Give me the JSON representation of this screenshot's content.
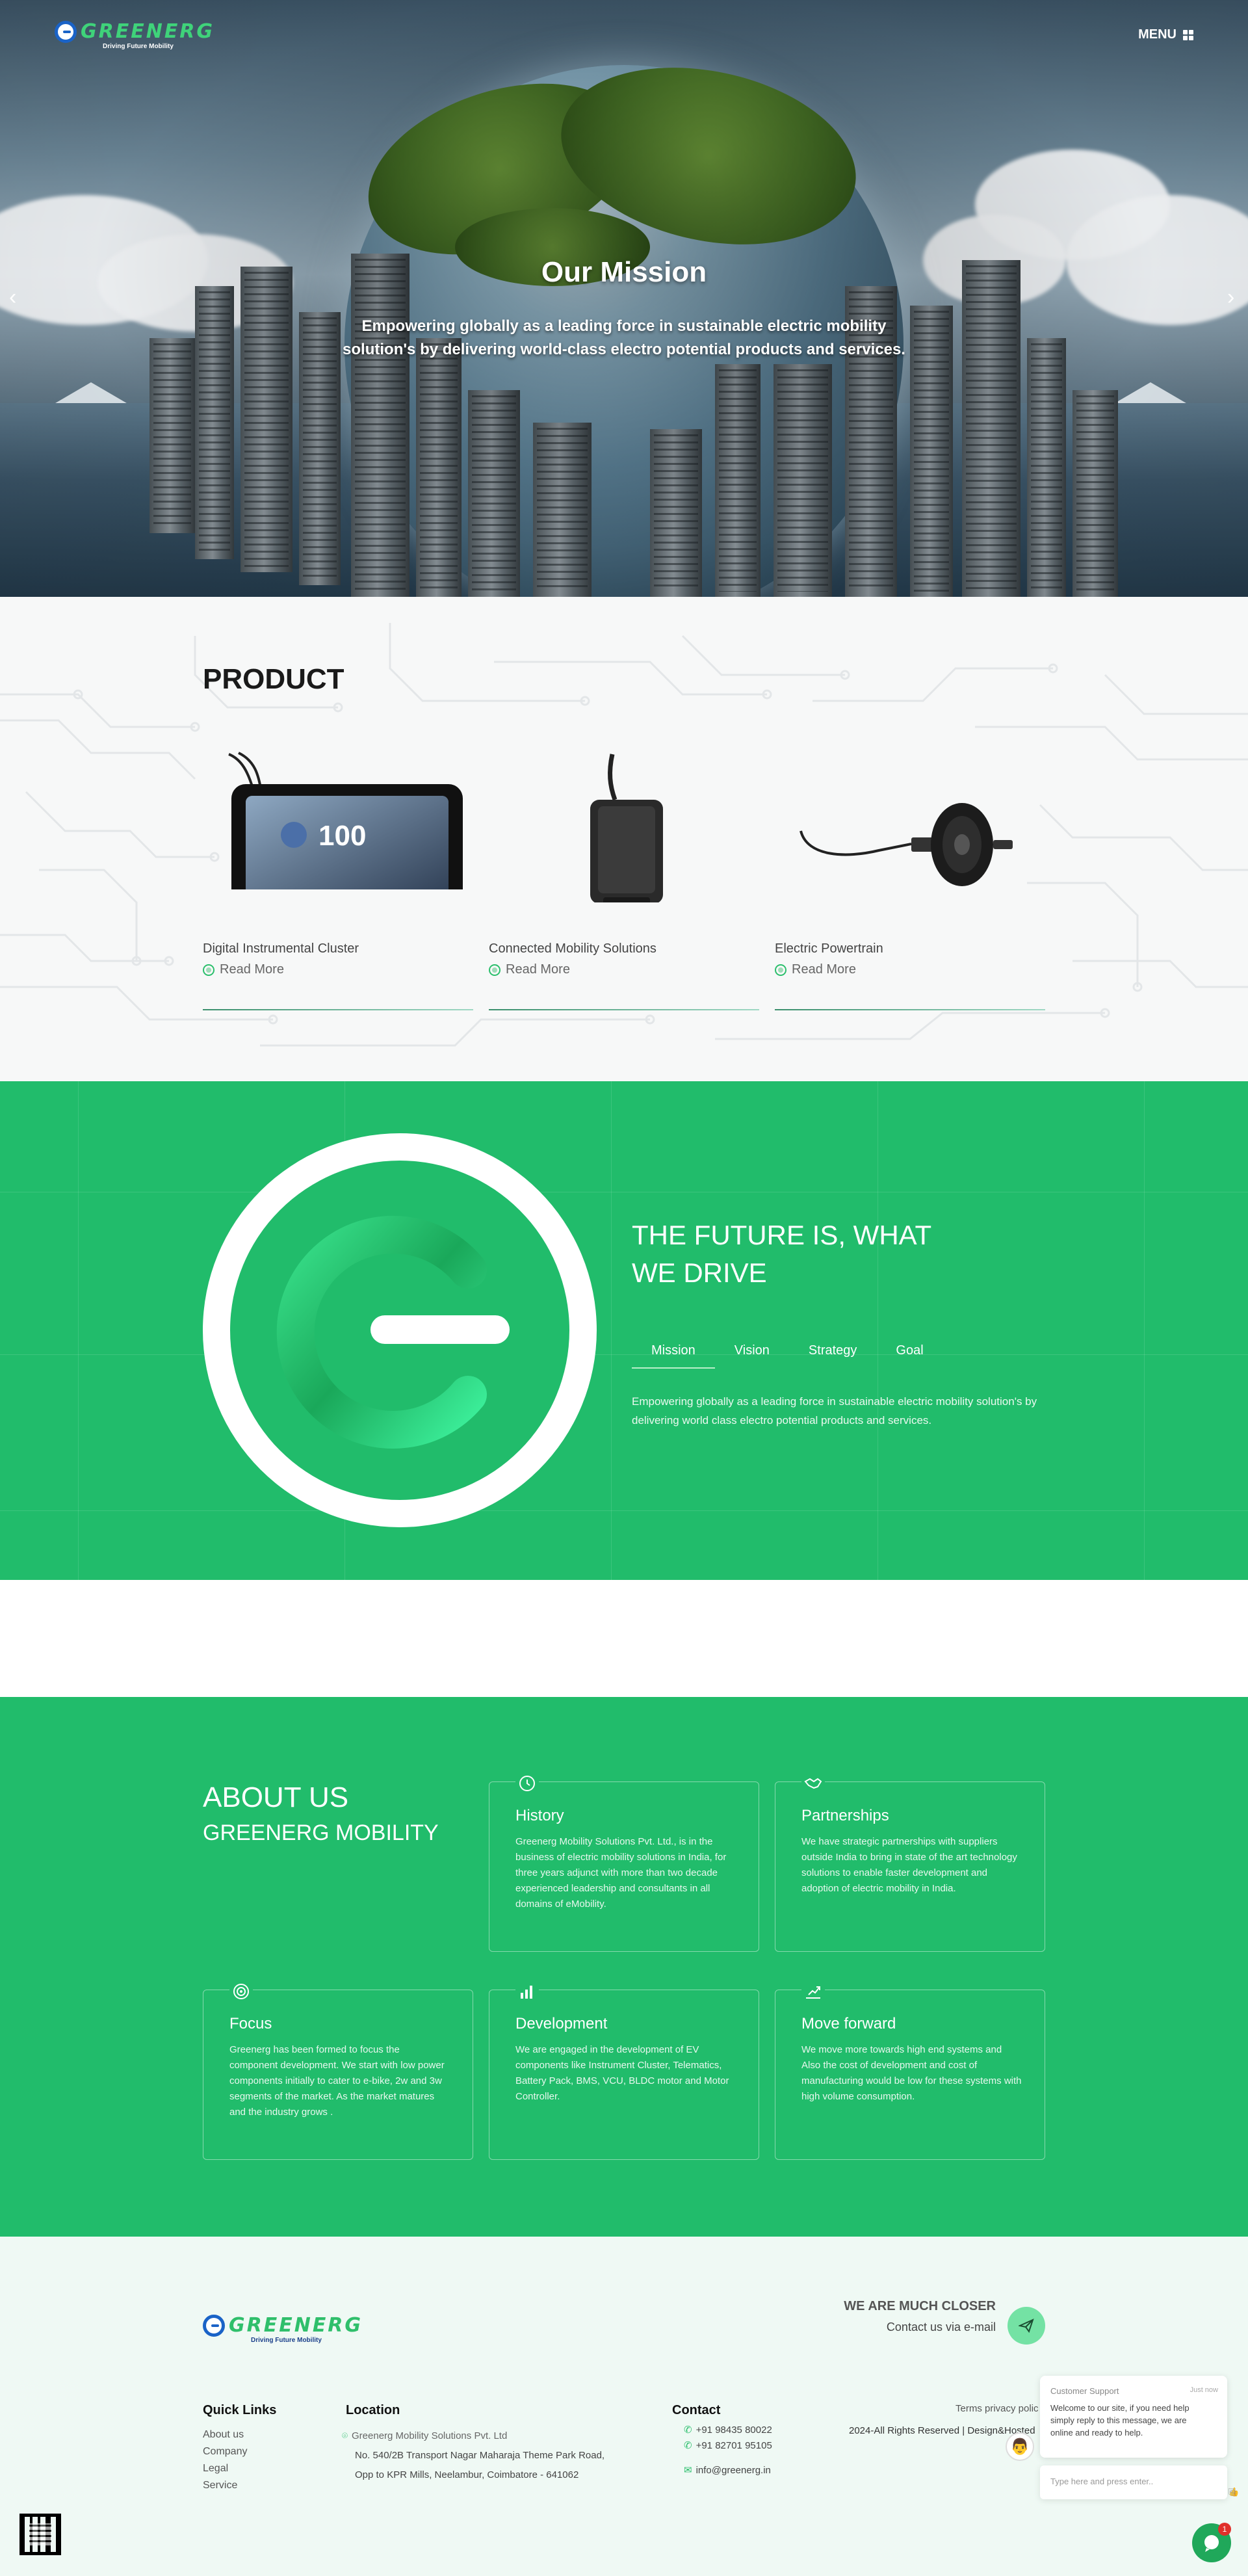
{
  "brand": {
    "name": "GREENERG",
    "tagline": "Driving Future Mobility",
    "accent": "#21bc6b",
    "logo_blue": "#1a63c7"
  },
  "nav": {
    "menu_label": "MENU"
  },
  "hero": {
    "title": "Our Mission",
    "subtitle": "Empowering globally as a leading force in sustainable electric mobility solution's by delivering world-class electro potential products and services.",
    "prev_icon": "‹",
    "next_icon": "›"
  },
  "product": {
    "heading": "PRODUCT",
    "items": [
      {
        "name": "Digital Instrumental Cluster",
        "more": "Read More",
        "icon": "instrument-cluster"
      },
      {
        "name": "Connected Mobility Solutions",
        "more": "Read More",
        "icon": "telematics-device"
      },
      {
        "name": "Electric Powertrain",
        "more": "Read More",
        "icon": "hub-motor"
      }
    ]
  },
  "future": {
    "heading_line1": "THE FUTURE IS, WHAT",
    "heading_line2": "WE DRIVE",
    "tabs": [
      "Mission",
      "Vision",
      "Strategy",
      "Goal"
    ],
    "active_tab": "Mission",
    "description": "Empowering globally as a leading force in sustainable electric mobility solution's by delivering world class electro potential products and services."
  },
  "about": {
    "heading": "ABOUT US",
    "subheading": "GREENERG MOBILITY",
    "cards": [
      {
        "title": "History",
        "icon": "history-icon",
        "body": "Greenerg Mobility Solutions Pvt. Ltd., is in the business of electric mobility solutions in India, for three years adjunct with more than two decade experienced leadership and consultants in all domains of eMobility."
      },
      {
        "title": "Partnerships",
        "icon": "handshake-icon",
        "body": "We have strategic partnerships with suppliers outside India to bring in state of the art technology solutions to enable faster development and adoption of electric mobility in India."
      },
      {
        "title": "Focus",
        "icon": "target-icon",
        "body": "Greenerg has been formed to focus the component development. We start with low power components initially to cater to e-bike, 2w and 3w segments of the market. As the market matures and the industry grows ."
      },
      {
        "title": "Development",
        "icon": "chart-icon",
        "body": "We are engaged in the development of EV components like Instrument Cluster, Telematics, Battery Pack, BMS, VCU, BLDC motor and Motor Controller."
      },
      {
        "title": "Move forward",
        "icon": "growth-icon",
        "body": "We move more towards high end systems and Also the cost of development and cost of manufacturing would be low for these systems with high volume consumption."
      }
    ]
  },
  "footer": {
    "closer_title": "WE ARE MUCH CLOSER",
    "closer_sub": "Contact us via e-mail",
    "quick_links_heading": "Quick Links",
    "quick_links": [
      "About us",
      "Company",
      "Legal",
      "Service"
    ],
    "location_heading": "Location",
    "location_lines": [
      "Greenerg Mobility Solutions Pvt. Ltd",
      "No. 540/2B Transport Nagar Maharaja Theme Park Road,",
      "Opp to KPR Mills, Neelambur, Coimbatore - 641062"
    ],
    "contact_heading": "Contact",
    "phones": [
      "+91 98435 80022",
      "+91 82701 95105"
    ],
    "email": "info@greenerg.in",
    "terms": "Terms privacy polic",
    "copyright": "2024-All Rights Reserved | Design&Hosted"
  },
  "chat": {
    "agent_label": "Customer Support",
    "time": "Just now",
    "message": "Welcome to our site, if you need help simply reply to this message, we are online and ready to help.",
    "placeholder": "Type here and press enter..",
    "unread": "1"
  }
}
